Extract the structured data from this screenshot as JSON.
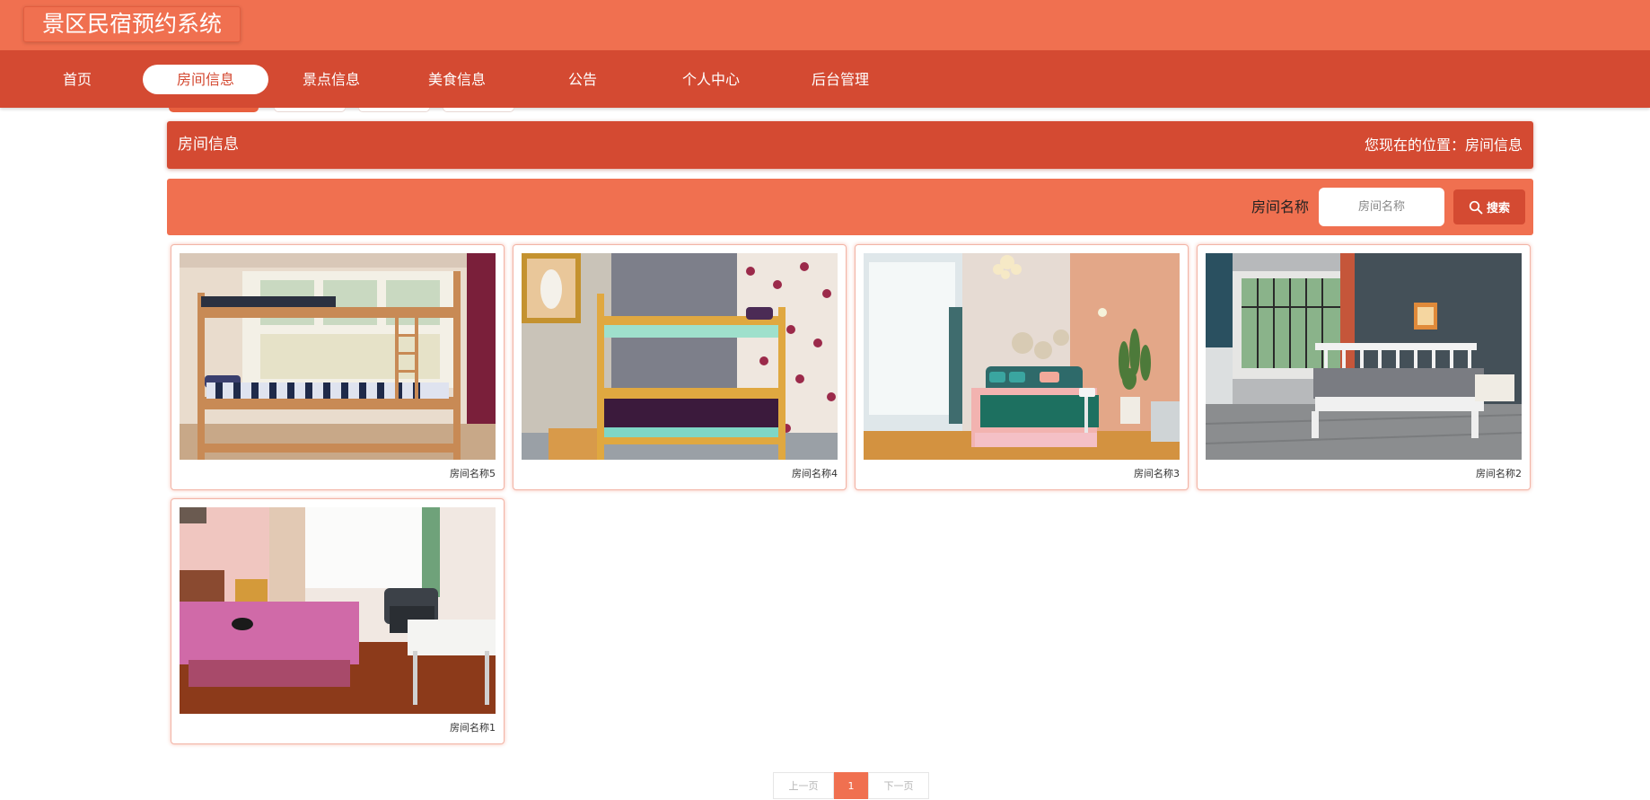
{
  "app": {
    "title": "景区民宿预约系统"
  },
  "nav": {
    "items": [
      {
        "label": "首页"
      },
      {
        "label": "房间信息"
      },
      {
        "label": "景点信息"
      },
      {
        "label": "美食信息"
      },
      {
        "label": "公告"
      },
      {
        "label": "个人中心"
      },
      {
        "label": "后台管理"
      }
    ],
    "active_index": 1
  },
  "breadcrumb": {
    "section_title": "房间信息",
    "location_text": "您现在的位置：房间信息"
  },
  "search": {
    "label": "房间名称",
    "placeholder": "房间名称",
    "value": "",
    "button_label": "搜索"
  },
  "rooms": [
    {
      "name": "房间名称5",
      "photo": "bunk-bed-wooden-dorm"
    },
    {
      "name": "房间名称4",
      "photo": "bunk-bed-grey-wall"
    },
    {
      "name": "房间名称3",
      "photo": "double-bed-pink-room"
    },
    {
      "name": "房间名称2",
      "photo": "white-bed-grey-wall"
    },
    {
      "name": "房间名称1",
      "photo": "pink-bedroom-window"
    }
  ],
  "pagination": {
    "prev_label": "上一页",
    "current_page": "1",
    "next_label": "下一页"
  },
  "colors": {
    "primary": "#f07050",
    "primary_dark": "#d44a32",
    "card_border": "#f2b4a6"
  }
}
